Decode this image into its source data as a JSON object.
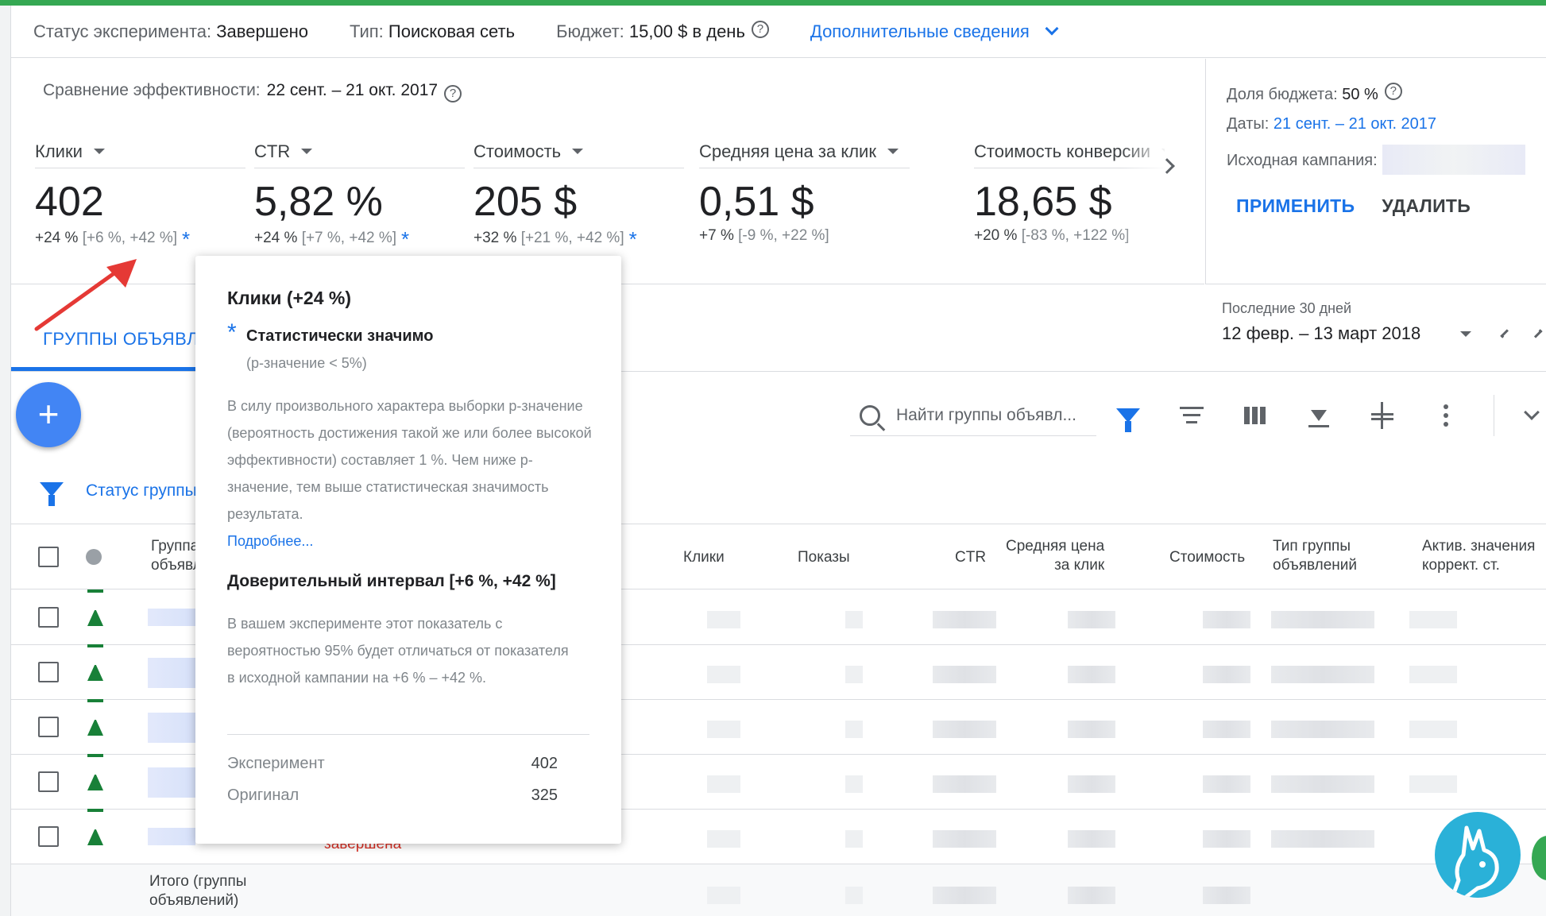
{
  "status_bar": {
    "status_label": "Статус эксперимента:",
    "status_value": "Завершено",
    "type_label": "Тип:",
    "type_value": "Поисковая сеть",
    "budget_label": "Бюджет:",
    "budget_value": "15,00 $ в день",
    "more_details": "Дополнительные сведения"
  },
  "comparison": {
    "title": "Сравнение эффективности:",
    "range": "22 сент. – 21 окт. 2017",
    "metrics": [
      {
        "label": "Клики",
        "value": "402",
        "delta": "+24 %",
        "ci": "[+6 %, +42 %]",
        "significant": "*"
      },
      {
        "label": "CTR",
        "value": "5,82 %",
        "delta": "+24 %",
        "ci": "[+7 %, +42 %]",
        "significant": "*"
      },
      {
        "label": "Стоимость",
        "value": "205 $",
        "delta": "+32 %",
        "ci": "[+21 %, +42 %]",
        "significant": "*"
      },
      {
        "label": "Средняя цена за клик",
        "value": "0,51 $",
        "delta": "+7 %",
        "ci": "[-9 %, +22 %]",
        "significant": ""
      },
      {
        "label": "Стоимость конверсии",
        "value": "18,65 $",
        "delta": "+20 %",
        "ci": "[-83 %, +122 %]",
        "significant": ""
      }
    ]
  },
  "side_panel": {
    "budget_share_label": "Доля бюджета:",
    "budget_share_value": "50 %",
    "dates_label": "Даты:",
    "dates_value": "21 сент. – 21 окт. 2017",
    "source_label": "Исходная кампания:",
    "apply": "ПРИМЕНИТЬ",
    "delete": "УДАЛИТЬ"
  },
  "tabs": {
    "active": "ГРУППЫ ОБЪЯВЛ"
  },
  "date_picker": {
    "label": "Последние 30 дней",
    "range": "12 февр. – 13 март 2018"
  },
  "toolbar": {
    "add": "+",
    "search_placeholder": "Найти группы объявл..."
  },
  "filter": {
    "text": "Статус группы"
  },
  "table": {
    "headers": {
      "group": [
        "Группа",
        "объявл"
      ],
      "clicks": "Клики",
      "impressions": "Показы",
      "ctr": "CTR",
      "avg_cpc": [
        "Средняя цена",
        "за клик"
      ],
      "cost": "Стоимость",
      "group_type": [
        "Тип группы",
        "объявлений"
      ],
      "active_values": [
        "Актив. значения",
        "коррект. ст."
      ]
    },
    "ended_status": "завершена",
    "total_label": [
      "Итого (группы",
      "объявлений)"
    ]
  },
  "tooltip": {
    "title": "Клики (+24 %)",
    "star": "*",
    "significance": "Статистически значимо",
    "p_value": "(р-значение < 5%)",
    "explanation": "В силу произвольного характера выборки р-значение (вероятность достижения такой же или более высокой эффективности) составляет 1 %. Чем ниже р-значение, тем выше статистическая значимость результата.",
    "more_link": "Подробнее...",
    "ci_title": "Доверительный интервал [+6 %, +42 %]",
    "ci_text": "В вашем эксперименте этот показатель с вероятностью 95% будет отличаться от показателя в исходной кампании на +6 % – +42 %.",
    "experiment_label": "Эксперимент",
    "experiment_value": "402",
    "original_label": "Оригинал",
    "original_value": "325"
  },
  "colors": {
    "accent_blue": "#1a73e8",
    "top_green": "#35a853",
    "arrow_red": "#e53935",
    "ended_red": "#d93025"
  }
}
